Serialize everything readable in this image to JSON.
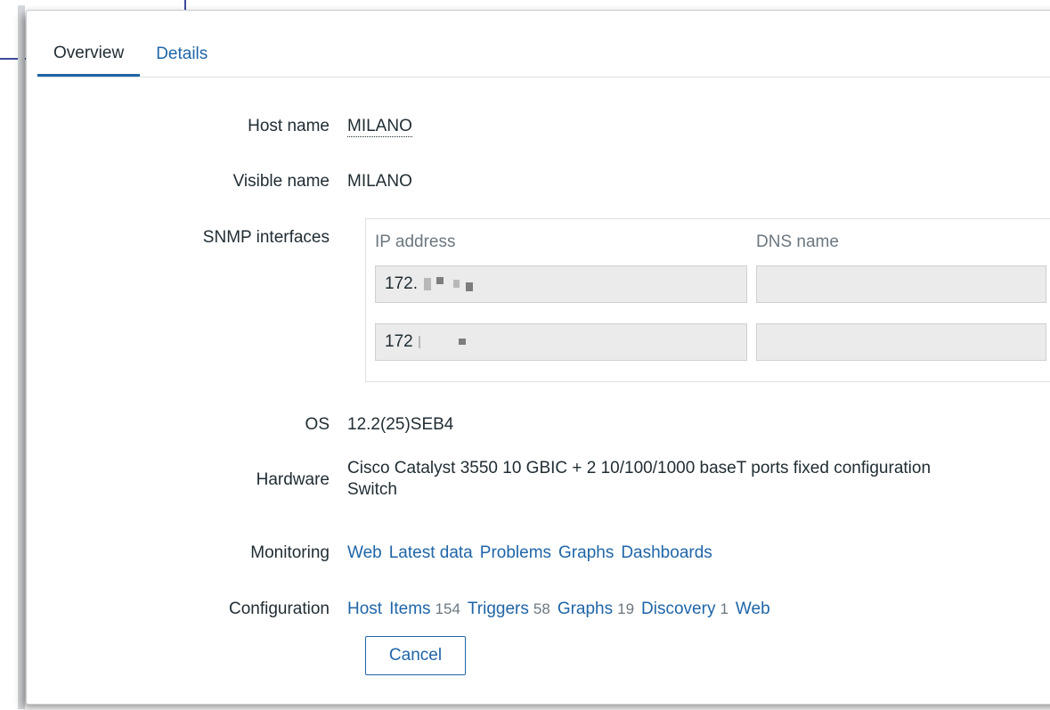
{
  "tabs": [
    {
      "label": "Overview",
      "active": true
    },
    {
      "label": "Details",
      "active": false
    }
  ],
  "host_name": {
    "label": "Host name",
    "value": "MILANO"
  },
  "visible_name": {
    "label": "Visible name",
    "value": "MILANO"
  },
  "snmp": {
    "label": "SNMP interfaces",
    "col_ip": "IP address",
    "col_dns": "DNS name",
    "rows": [
      {
        "ip": "172.",
        "dns": ""
      },
      {
        "ip": "172",
        "dns": ""
      }
    ]
  },
  "os": {
    "label": "OS",
    "value": "12.2(25)SEB4"
  },
  "hardware": {
    "label": "Hardware",
    "line1": "Cisco Catalyst 3550 10 GBIC + 2 10/100/1000 baseT ports fixed configuration",
    "line2": "Switch"
  },
  "monitoring": {
    "label": "Monitoring",
    "links": [
      "Web",
      "Latest data",
      "Problems",
      "Graphs",
      "Dashboards"
    ]
  },
  "configuration": {
    "label": "Configuration",
    "host": "Host",
    "items": "Items",
    "items_count": "154",
    "triggers": "Triggers",
    "triggers_count": "58",
    "graphs": "Graphs",
    "graphs_count": "19",
    "discovery": "Discovery",
    "discovery_count": "1",
    "web": "Web"
  },
  "cancel_label": "Cancel",
  "colors": {
    "link": "#1f65a8",
    "text": "#1f2c33",
    "muted": "#6b7780",
    "field_bg": "#ebebeb"
  }
}
